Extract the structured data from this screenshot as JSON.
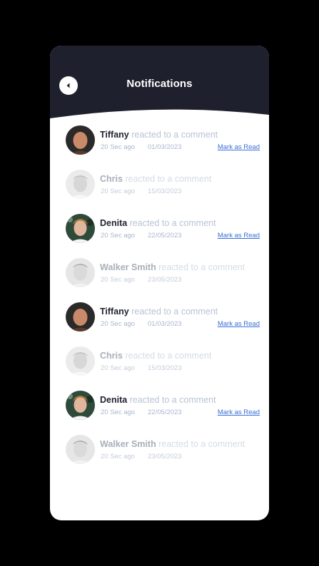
{
  "header": {
    "title": "Notifications",
    "back_icon": "back-arrow-icon",
    "background": "#1e202d"
  },
  "notifications": [
    {
      "name": "Tiffany",
      "action": "reacted to a comment",
      "time": "20 Sec ago",
      "date": "01/03/2023",
      "mark_label": "Mark as Read",
      "read": false
    },
    {
      "name": "Chris",
      "action": "reacted to a comment",
      "time": "20 Sec ago",
      "date": "15/03/2023",
      "mark_label": "",
      "read": true
    },
    {
      "name": "Denita",
      "action": "reacted to a comment",
      "time": "20 Sec ago",
      "date": "22/05/2023",
      "mark_label": "Mark as Read",
      "read": false
    },
    {
      "name": "Walker Smith",
      "action": "reacted to a comment",
      "time": "20 Sec ago",
      "date": "23/05/2023",
      "mark_label": "",
      "read": true
    },
    {
      "name": "Tiffany",
      "action": "reacted to a comment",
      "time": "20 Sec ago",
      "date": "01/03/2023",
      "mark_label": "Mark as Read",
      "read": false
    },
    {
      "name": "Chris",
      "action": "reacted to a comment",
      "time": "20 Sec ago",
      "date": "15/03/2023",
      "mark_label": "",
      "read": true
    },
    {
      "name": "Denita",
      "action": "reacted to a comment",
      "time": "20 Sec ago",
      "date": "22/05/2023",
      "mark_label": "Mark as Read",
      "read": false
    },
    {
      "name": "Walker Smith",
      "action": "reacted to a comment",
      "time": "20 Sec ago",
      "date": "23/05/2023",
      "mark_label": "",
      "read": true
    }
  ],
  "colors": {
    "accent_link": "#3a6fd6",
    "unread_name": "#1f2230",
    "muted_text": "#b8c3d6"
  }
}
